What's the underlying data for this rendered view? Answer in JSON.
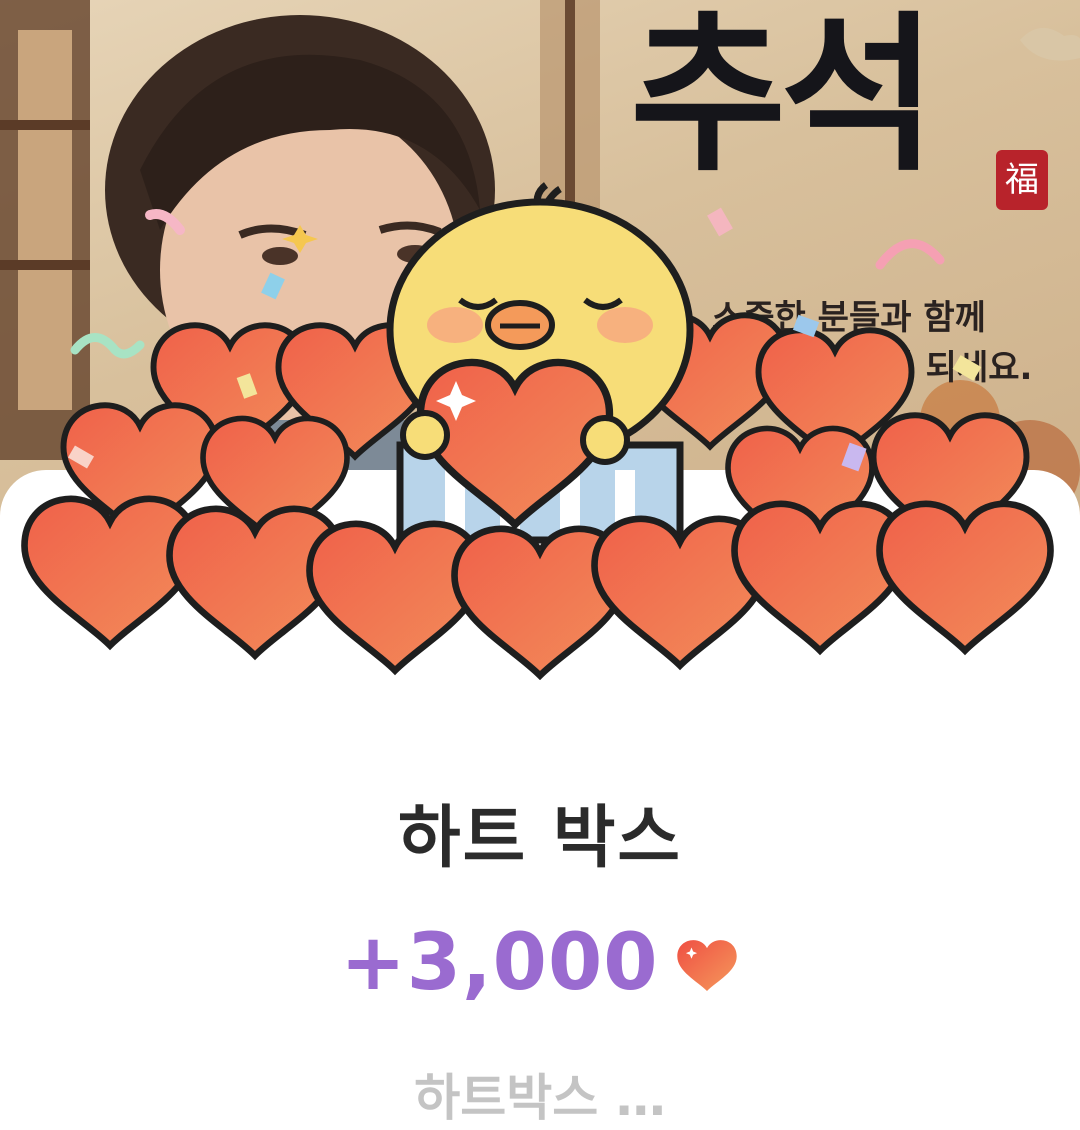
{
  "banner": {
    "festival_title": "추석",
    "stamp_char": "福",
    "greeting_line1": "소중한 분들과 함께",
    "greeting_line2": "한가위 되세요."
  },
  "reward": {
    "title": "하트 박스",
    "amount": "+3,000",
    "currency_icon": "heart-icon",
    "description": "하트박스 …"
  },
  "colors": {
    "amount": "#9a6bd0",
    "title": "#2b2b2b",
    "heart": "#ef6a4a",
    "chick": "#f7dd78"
  }
}
